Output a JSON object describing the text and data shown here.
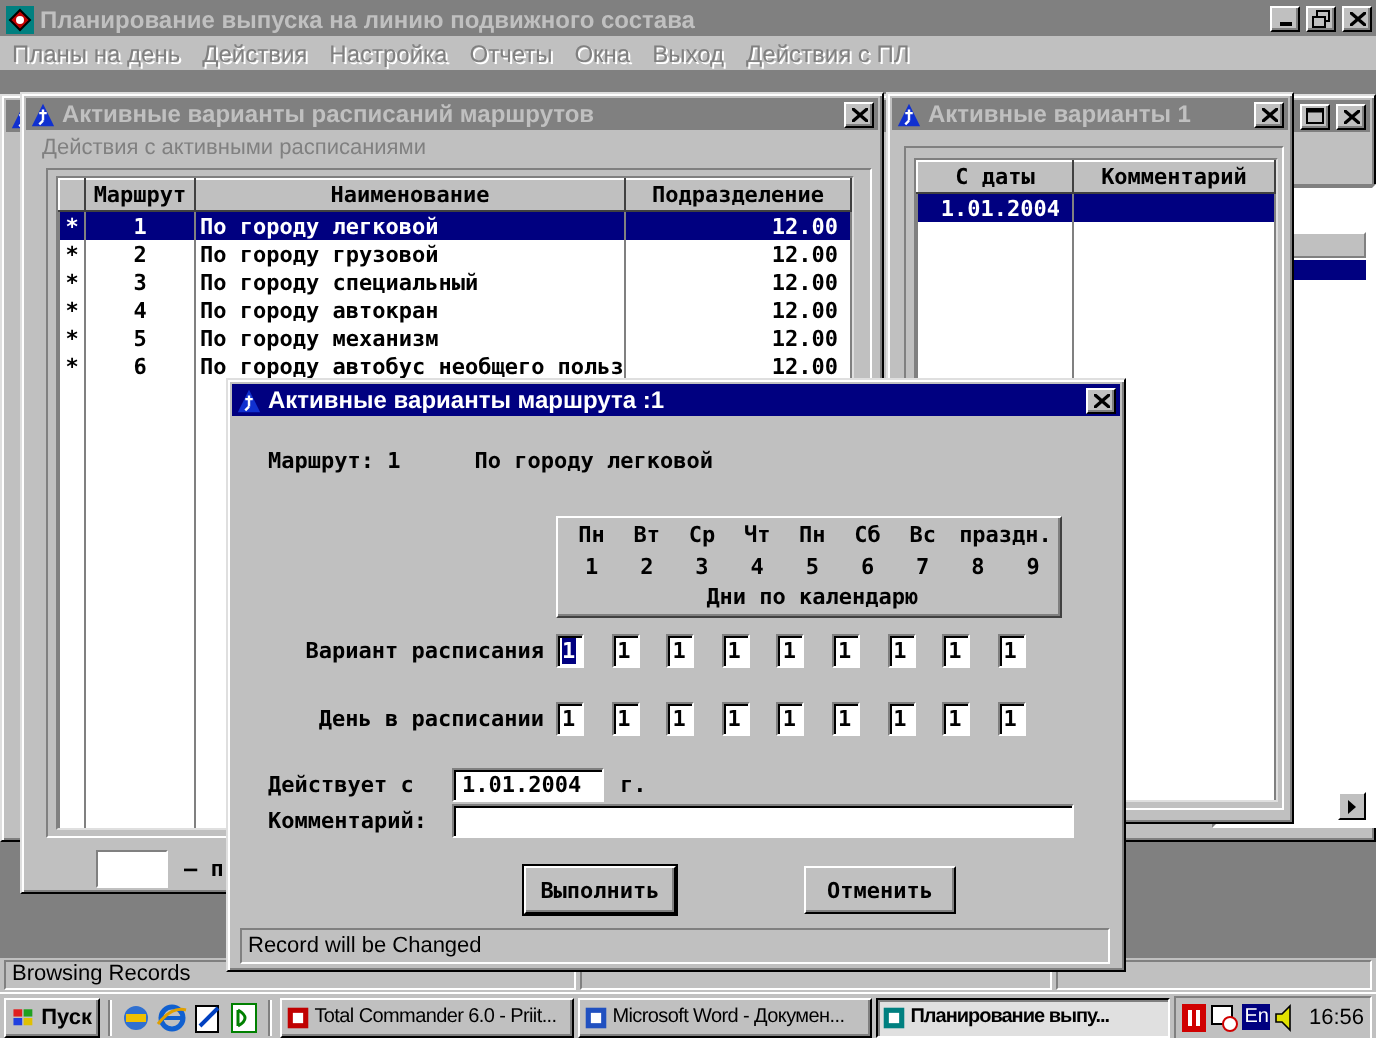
{
  "app": {
    "title": "Планирование выпуска на линию подвижного состава",
    "active": false,
    "menu": [
      {
        "label": "Планы на день",
        "disabled": true
      },
      {
        "label": "Действия",
        "disabled": true
      },
      {
        "label": "Настройка",
        "disabled": true
      },
      {
        "label": "Отчеты",
        "disabled": true
      },
      {
        "label": "Окна",
        "disabled": true
      },
      {
        "label": "Выход",
        "disabled": true
      },
      {
        "label": "Действия с ПЛ",
        "disabled": true
      }
    ]
  },
  "routes_window": {
    "title": "Активные варианты расписаний маршрутов",
    "active": false,
    "menu_label": "Действия с активными расписаниями",
    "columns": [
      "Маршрут",
      "Наименование",
      "Подразделение"
    ],
    "rows": [
      {
        "marker": "*",
        "number": "1",
        "name": "По городу легковой",
        "unit": "12.00",
        "selected": true
      },
      {
        "marker": "*",
        "number": "2",
        "name": "По городу грузовой",
        "unit": "12.00",
        "selected": false
      },
      {
        "marker": "*",
        "number": "3",
        "name": "По городу специальный",
        "unit": "12.00",
        "selected": false
      },
      {
        "marker": "*",
        "number": "4",
        "name": "По городу автокран",
        "unit": "12.00",
        "selected": false
      },
      {
        "marker": "*",
        "number": "5",
        "name": "По городу механизм",
        "unit": "12.00",
        "selected": false
      },
      {
        "marker": "*",
        "number": "6",
        "name": "По городу автобус необщего польз",
        "unit": "12.00",
        "selected": false
      }
    ],
    "footer_text": "– п"
  },
  "variants_window": {
    "title": "Активные варианты 1",
    "active": false,
    "columns": [
      "С даты",
      "Комментарий"
    ],
    "rows": [
      {
        "date": "1.01.2004",
        "selected": true
      }
    ]
  },
  "dialog": {
    "title": "Активные варианты маршрута :1",
    "active": true,
    "route_label": "Маршрут: 1",
    "route_name": "По городу легковой",
    "day_names": [
      "Пн",
      "Вт",
      "Ср",
      "Чт",
      "Пн",
      "Сб",
      "Вс",
      "праздн."
    ],
    "day_numbers": [
      "1",
      "2",
      "3",
      "4",
      "5",
      "6",
      "7",
      "8",
      "9"
    ],
    "days_caption": "Дни по календарю",
    "variant_label": "Вариант расписания",
    "variant_values": [
      {
        "value": "1",
        "focused": true
      },
      {
        "value": "1",
        "focused": false
      },
      {
        "value": "1",
        "focused": false
      },
      {
        "value": "1",
        "focused": false
      },
      {
        "value": "1",
        "focused": false
      },
      {
        "value": "1",
        "focused": false
      },
      {
        "value": "1",
        "focused": false
      },
      {
        "value": "1",
        "focused": false
      },
      {
        "value": "1",
        "focused": false
      }
    ],
    "day_label": "День в расписании",
    "day_values": [
      "1",
      "1",
      "1",
      "1",
      "1",
      "1",
      "1",
      "1",
      "1"
    ],
    "valid_from_label": "Действует с",
    "valid_from": "1.01.2004",
    "year_suffix": "г.",
    "comment_label": "Комментарий:",
    "buttons": [
      {
        "label": "Выполнить",
        "default": true
      },
      {
        "label": "Отменить",
        "default": false
      }
    ],
    "status": "Record will be Changed"
  },
  "status_bar": [
    "Browsing Records"
  ],
  "taskbar": {
    "start": "Пуск",
    "tasks": [
      {
        "label": "Total Commander 6.0 - Priit...",
        "selected": false
      },
      {
        "label": "Microsoft Word - Докумен...",
        "selected": false
      },
      {
        "label": "Планирование выпу...",
        "selected": true
      }
    ],
    "language": "En",
    "time": "16:56"
  }
}
